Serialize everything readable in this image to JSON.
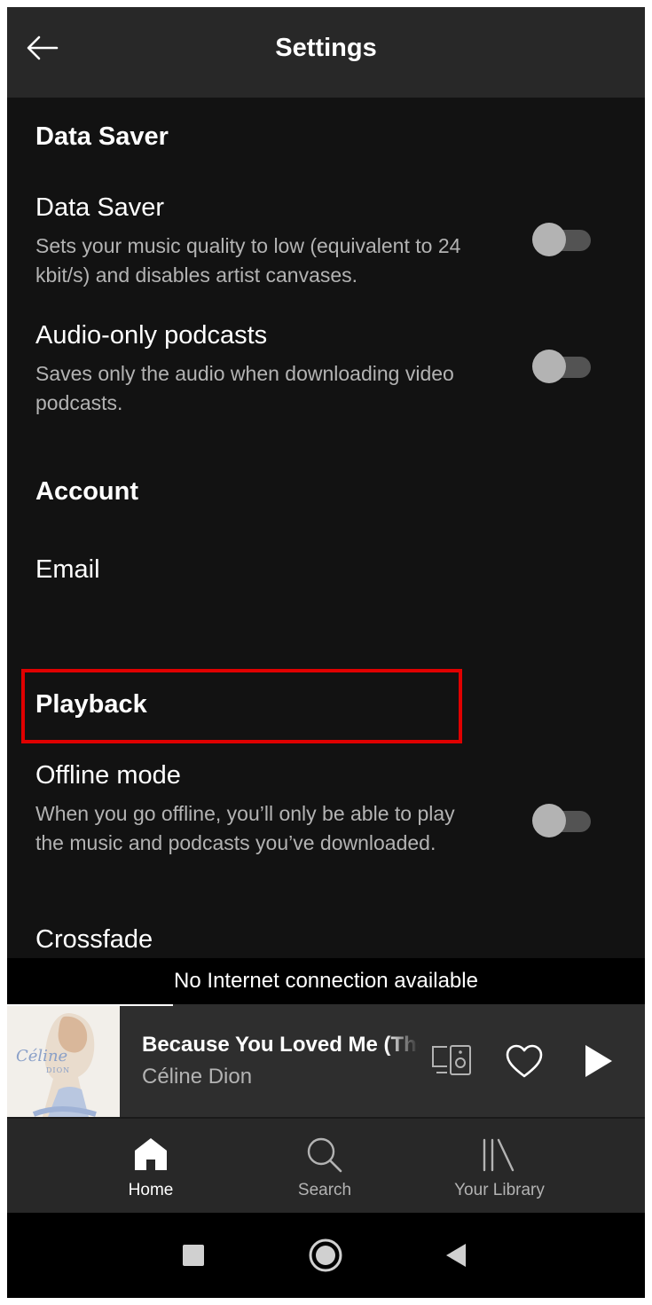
{
  "header": {
    "title": "Settings"
  },
  "sections": {
    "data_saver": {
      "title": "Data Saver",
      "rows": [
        {
          "title": "Data Saver",
          "description": "Sets your music quality to low (equivalent to 24 kbit/s) and disables artist canvases.",
          "enabled": false
        },
        {
          "title": "Audio-only podcasts",
          "description": "Saves only the audio when downloading video podcasts.",
          "enabled": false
        }
      ]
    },
    "account": {
      "title": "Account",
      "rows": [
        {
          "title": "Email"
        }
      ]
    },
    "playback": {
      "title": "Playback",
      "rows": [
        {
          "title": "Offline mode",
          "description": "When you go offline, you’ll only be able to play the music and podcasts you’ve downloaded.",
          "enabled": false
        },
        {
          "title": "Crossfade"
        }
      ]
    }
  },
  "offline_banner": "No Internet connection available",
  "now_playing": {
    "title": "Because You Loved Me (Theme from Up Close and Personal)",
    "artist": "Céline Dion",
    "cover_text": {
      "script": "Céline",
      "sub": "DION"
    },
    "progress": 0.26,
    "liked": false
  },
  "bottom_nav": {
    "items": [
      {
        "label": "Home",
        "active": true
      },
      {
        "label": "Search",
        "active": false
      },
      {
        "label": "Your Library",
        "active": false
      }
    ]
  },
  "colors": {
    "background": "#121212",
    "header": "#282828",
    "highlight": "#e00000",
    "text_primary": "#ffffff",
    "text_secondary": "#b3b3b3"
  }
}
